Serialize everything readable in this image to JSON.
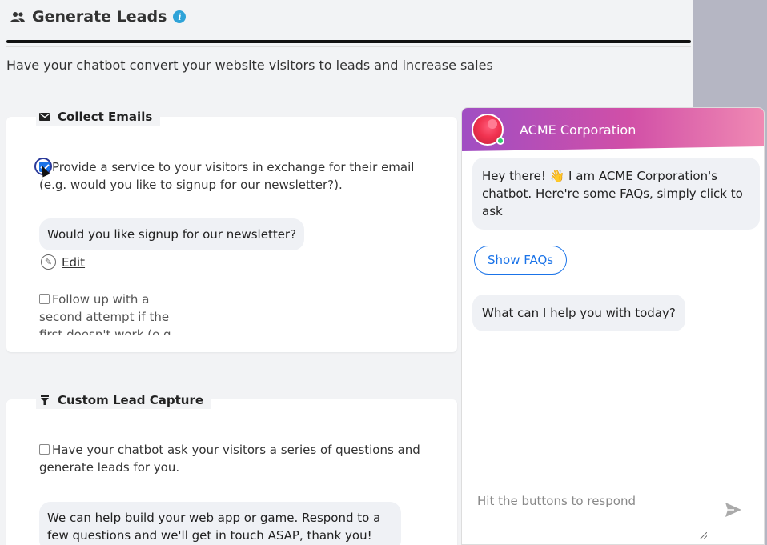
{
  "header": {
    "title": "Generate Leads",
    "icon": "people-icon",
    "info_icon": "info-icon",
    "subtitle": "Have your chatbot convert your website visitors to leads and increase sales"
  },
  "collect_emails": {
    "legend": "Collect Emails",
    "icon": "envelope-icon",
    "option_label": "Provide a service to your visitors in exchange for their email (e.g. would you like to signup for our newsletter?).",
    "option_checked": true,
    "preview_message": "Would you like signup for our newsletter?",
    "edit_label": "Edit",
    "followup_label": "Follow up with a second attempt if the first doesn't work (e.g.",
    "followup_checked": false
  },
  "custom_lead": {
    "legend": "Custom Lead Capture",
    "icon": "filter-icon",
    "option_label": "Have your chatbot ask your visitors a series of questions and generate leads for you.",
    "option_checked": false,
    "preview_message": "We can help build your web app or game. Respond to a few questions and we'll get in touch ASAP, thank you!"
  },
  "chat": {
    "company": "ACME Corporation",
    "greeting": "Hey there! 👋 I am ACME Corporation's chatbot. Here're some FAQs, simply click to ask",
    "faq_button": "Show FAQs",
    "prompt": "What can I help you with today?",
    "input_placeholder": "Hit the buttons to respond",
    "accent_color": "#1a73e8",
    "header_gradient": [
      "#a04ec3",
      "#d14fa7",
      "#f08ab3"
    ]
  }
}
